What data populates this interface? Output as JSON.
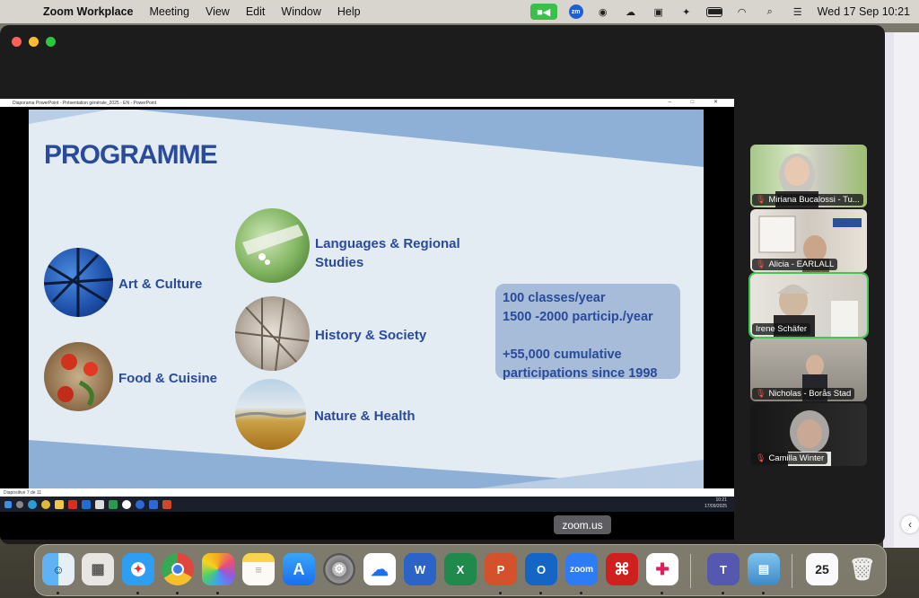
{
  "menubar": {
    "app_name": "Zoom Workplace",
    "menus": [
      "Meeting",
      "View",
      "Edit",
      "Window",
      "Help"
    ],
    "clock": "Wed 17 Sep  10:21",
    "zoom_badge": "zm"
  },
  "ppt": {
    "window_title": "Diaporama PowerPoint - Présentation générale_2025 - EN - PowerPoint",
    "status_text": "Diapositive 7 de 11",
    "taskbar_time": "10:21",
    "taskbar_date": "17/09/2025"
  },
  "slide": {
    "title": "PROGRAMME",
    "topics": {
      "art": "Art & Culture",
      "food": "Food & Cuisine",
      "languages_1": "Languages & Regional",
      "languages_2": "Studies",
      "history": "History & Society",
      "nature": "Nature & Health"
    },
    "stats": {
      "line1": "100 classes/year",
      "line2": "1500 -2000 particip./year",
      "line3": "+55,000 cumulative",
      "line4": "participations since 1998"
    }
  },
  "participants": [
    {
      "name": "Miriana Bucalossi - Tu...",
      "muted": true
    },
    {
      "name": "Alicia - EARLALL",
      "muted": true
    },
    {
      "name": "Irene Schäfer",
      "muted": false,
      "active_speaker": true
    },
    {
      "name": "Nicholas - Borås Stad",
      "muted": true
    },
    {
      "name": "Camilla Winter",
      "muted": true
    }
  ],
  "tooltip": "zoom.us",
  "dock": {
    "zoom_label": "zoom",
    "calendar_day": "25",
    "word_letter": "W",
    "excel_letter": "X",
    "ppt_letter": "P",
    "outlook_letter": "O",
    "teams_letter": "T"
  },
  "colors": {
    "slide_blue": "#2a4a9a",
    "slide_bg": "#e3ebf3",
    "stats_box": "#a7bcd8",
    "active_speaker": "#3fc653",
    "zoom_video_button": "#3bbf4b"
  }
}
